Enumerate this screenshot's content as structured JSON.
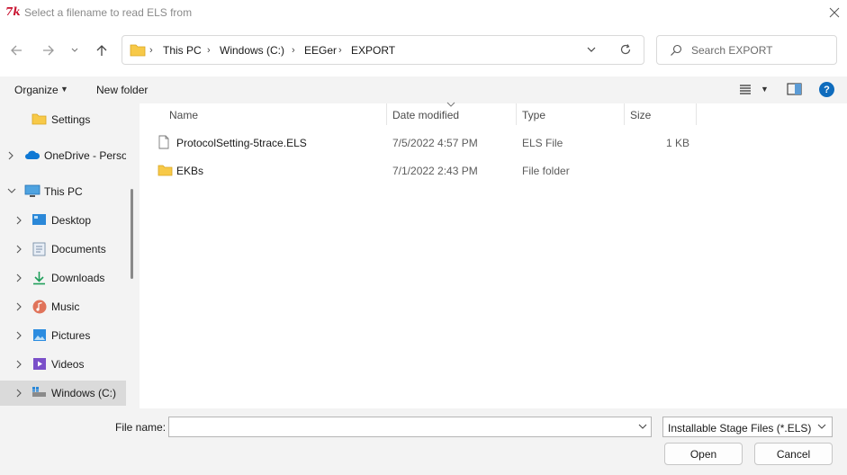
{
  "window": {
    "title": "Select a filename to read ELS from",
    "app_logo_text": "7k"
  },
  "address": {
    "crumbs": [
      "This PC",
      "Windows (C:)",
      "EEGer",
      "EXPORT"
    ]
  },
  "search": {
    "placeholder": "Search EXPORT"
  },
  "toolbar": {
    "organize_label": "Organize",
    "new_folder_label": "New folder"
  },
  "sidebar": {
    "items": [
      {
        "label": "Settings",
        "icon": "folder-icon"
      },
      {
        "label": "OneDrive - Perso",
        "icon": "onedrive-icon"
      },
      {
        "label": "This PC",
        "icon": "monitor-icon"
      },
      {
        "label": "Desktop",
        "icon": "desktop-icon"
      },
      {
        "label": "Documents",
        "icon": "documents-icon"
      },
      {
        "label": "Downloads",
        "icon": "downloads-icon"
      },
      {
        "label": "Music",
        "icon": "music-icon"
      },
      {
        "label": "Pictures",
        "icon": "pictures-icon"
      },
      {
        "label": "Videos",
        "icon": "videos-icon"
      },
      {
        "label": "Windows (C:)",
        "icon": "drive-icon"
      }
    ]
  },
  "filelist": {
    "columns": [
      "Name",
      "Date modified",
      "Type",
      "Size"
    ],
    "rows": [
      {
        "name": "ProtocolSetting-5trace.ELS",
        "date": "7/5/2022 4:57 PM",
        "type": "ELS File",
        "size": "1 KB",
        "icon": "file-icon"
      },
      {
        "name": "EKBs",
        "date": "7/1/2022 2:43 PM",
        "type": "File folder",
        "size": "",
        "icon": "folder-icon"
      }
    ]
  },
  "footer": {
    "filename_label": "File name:",
    "filename_value": "",
    "filter_value": "Installable Stage Files (*.ELS)",
    "open_label": "Open",
    "cancel_label": "Cancel"
  },
  "colors": {
    "accent": "#0f6cbd",
    "folder": "#f7c948",
    "selection": "#dadada",
    "pane_background": "#f3f3f3"
  }
}
